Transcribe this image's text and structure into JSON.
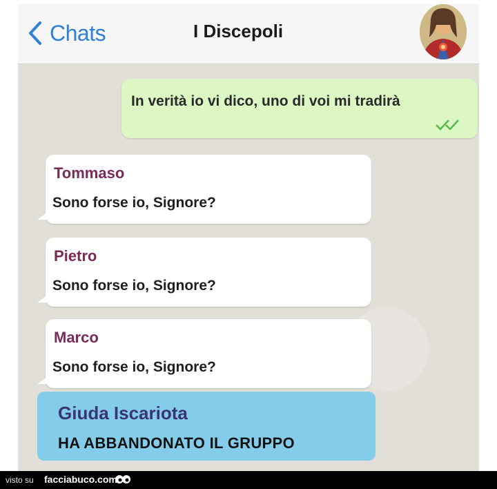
{
  "header": {
    "back_label": "Chats",
    "title": "I Discepoli",
    "avatar_icon": "jesus-portrait-avatar"
  },
  "messages": [
    {
      "type": "outgoing",
      "text": "In verità io vi dico, uno di voi mi tradirà",
      "status": "read"
    },
    {
      "type": "incoming",
      "sender": "Tommaso",
      "text": "Sono forse io, Signore?"
    },
    {
      "type": "incoming",
      "sender": "Pietro",
      "text": "Sono forse io, Signore?"
    },
    {
      "type": "incoming",
      "sender": "Marco",
      "text": "Sono forse io, Signore?"
    },
    {
      "type": "system",
      "sender": "Giuda Iscariota",
      "text": "HA ABBANDONATO IL GRUPPO"
    }
  ],
  "footer": {
    "visto_label": "visto su",
    "site": "facciabuco.com"
  },
  "colors": {
    "accent": "#2f80d8",
    "outgoing_bubble": "#dcf6c4",
    "incoming_bubble": "#ffffff",
    "sender_name": "#7a2a56",
    "system_bubble": "#84cdea",
    "ticks": "#56b84a"
  }
}
